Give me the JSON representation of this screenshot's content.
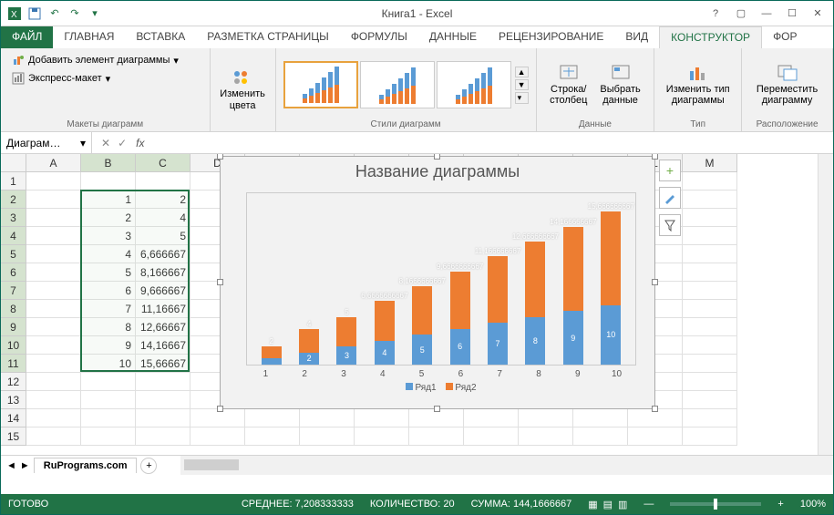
{
  "title": "Книга1 - Excel",
  "qat": {
    "icons": [
      "excel",
      "save",
      "undo",
      "redo",
      "qat-more"
    ]
  },
  "window_controls": {
    "help": "?",
    "ribbon_min": "▢",
    "min": "—",
    "max": "☐",
    "close": "✕"
  },
  "ribbon_tabs": [
    "ФАЙЛ",
    "ГЛАВНАЯ",
    "ВСТАВКА",
    "РАЗМЕТКА СТРАНИЦЫ",
    "ФОРМУЛЫ",
    "ДАННЫЕ",
    "РЕЦЕНЗИРОВАНИЕ",
    "ВИД",
    "КОНСТРУКТОР",
    "ФОР"
  ],
  "ribbon_active": 8,
  "ribbon": {
    "layouts": {
      "label": "Макеты диаграмм",
      "add_element": "Добавить элемент диаграммы",
      "quick_layout": "Экспресс-макет"
    },
    "colors": {
      "change": "Изменить\nцвета"
    },
    "styles": {
      "label": "Стили диаграмм"
    },
    "data": {
      "label": "Данные",
      "switch": "Строка/\nстолбец",
      "select": "Выбрать\nданные"
    },
    "type": {
      "label": "Тип",
      "change": "Изменить тип\nдиаграммы"
    },
    "location": {
      "label": "Расположение",
      "move": "Переместить\nдиаграмму"
    }
  },
  "namebox": "Диаграм…",
  "fx": "",
  "columns": [
    "A",
    "B",
    "C",
    "D",
    "E",
    "F",
    "G",
    "H",
    "I",
    "J",
    "K",
    "L",
    "M"
  ],
  "rows_shown": [
    1,
    2,
    3,
    4,
    5,
    6,
    7,
    8,
    9,
    10,
    11,
    12,
    13,
    14,
    15
  ],
  "table": {
    "B": [
      "",
      "1",
      "2",
      "3",
      "4",
      "5",
      "6",
      "7",
      "8",
      "9",
      "10"
    ],
    "C": [
      "",
      "2",
      "4",
      "5",
      "6,666667",
      "8,166667",
      "9,666667",
      "11,16667",
      "12,66667",
      "14,16667",
      "15,66667"
    ]
  },
  "selection": {
    "colStart": "B",
    "colEnd": "C",
    "rowStart": 2,
    "rowEnd": 11
  },
  "chart_obj": {
    "title": "Название диаграммы",
    "legend": [
      "Ряд1",
      "Ряд2"
    ],
    "side_buttons": [
      "plus",
      "brush",
      "filter"
    ]
  },
  "chart_data": {
    "type": "bar",
    "stacked": true,
    "categories": [
      1,
      2,
      3,
      4,
      5,
      6,
      7,
      8,
      9,
      10
    ],
    "series": [
      {
        "name": "Ряд1",
        "values": [
          1,
          2,
          3,
          4,
          5,
          6,
          7,
          8,
          9,
          10
        ]
      },
      {
        "name": "Ряд2",
        "values": [
          2,
          4,
          5,
          6.666667,
          8.166667,
          9.666667,
          11.16667,
          12.66667,
          14.16667,
          15.66667
        ]
      }
    ],
    "data_labels_s1": [
      "",
      "2",
      "3",
      "4",
      "5",
      "6",
      "7",
      "8",
      "9",
      "10"
    ],
    "data_labels_s2": [
      "2",
      "4",
      "5",
      "6,6666666667",
      "8,1666666667",
      "9,6666666667",
      "11,166666667",
      "12,666666667",
      "14,166666667",
      "15,666666667"
    ],
    "title": "Название диаграммы",
    "xlabel": "",
    "ylabel": "",
    "ylim": [
      0,
      26
    ]
  },
  "sheets": {
    "active": "RuPrograms.com"
  },
  "statusbar": {
    "ready": "ГОТОВО",
    "average_label": "СРЕДНЕЕ:",
    "average": "7,208333333",
    "count_label": "КОЛИЧЕСТВО:",
    "count": "20",
    "sum_label": "СУММА:",
    "sum": "144,1666667",
    "zoom": "100%"
  },
  "colors": {
    "s1": "#5b9bd5",
    "s2": "#ed7d31",
    "accent": "#217346"
  }
}
